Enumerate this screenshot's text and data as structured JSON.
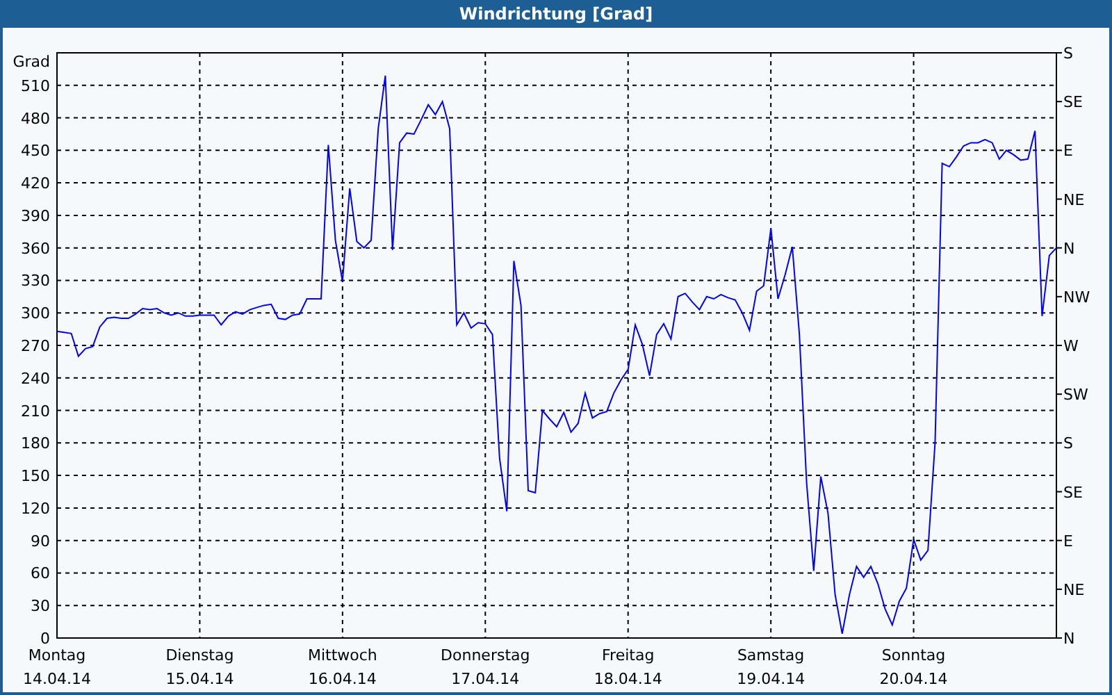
{
  "window": {
    "title": "Windrichtung [Grad]"
  },
  "chart": {
    "right_axis_labels": [
      "S",
      "SE",
      "E",
      "NE",
      "N",
      "NW",
      "W",
      "SW",
      "S",
      "SE",
      "E",
      "NE",
      "N"
    ],
    "x_axis_dates": [
      "14.04.14",
      "15.04.14",
      "16.04.14",
      "17.04.14",
      "18.04.14",
      "19.04.14",
      "20.04.14"
    ],
    "chart_data": {
      "type": "line",
      "ylabel": "Grad",
      "ylim": [
        0,
        540
      ],
      "grid": true,
      "yticks": [
        {
          "value": 0,
          "label": "0"
        },
        {
          "value": 30,
          "label": "30"
        },
        {
          "value": 60,
          "label": "60"
        },
        {
          "value": 90,
          "label": "90"
        },
        {
          "value": 120,
          "label": "120"
        },
        {
          "value": 150,
          "label": "150"
        },
        {
          "value": 180,
          "label": "180"
        },
        {
          "value": 210,
          "label": "210"
        },
        {
          "value": 240,
          "label": "240"
        },
        {
          "value": 270,
          "label": "270"
        },
        {
          "value": 300,
          "label": "300"
        },
        {
          "value": 330,
          "label": "330"
        },
        {
          "value": 360,
          "label": "360"
        },
        {
          "value": 390,
          "label": "390"
        },
        {
          "value": 420,
          "label": "420"
        },
        {
          "value": 450,
          "label": "450"
        },
        {
          "value": 480,
          "label": "480"
        },
        {
          "value": 510,
          "label": "510"
        }
      ],
      "categories": [
        "Montag",
        null,
        null,
        null,
        null,
        null,
        null,
        null,
        null,
        null,
        null,
        null,
        null,
        null,
        null,
        null,
        null,
        null,
        null,
        null,
        "Dienstag",
        null,
        null,
        null,
        null,
        null,
        null,
        null,
        null,
        null,
        null,
        null,
        null,
        null,
        null,
        null,
        null,
        null,
        null,
        null,
        "Mittwoch",
        null,
        null,
        null,
        null,
        null,
        null,
        null,
        null,
        null,
        null,
        null,
        null,
        null,
        null,
        null,
        null,
        null,
        null,
        null,
        "Donnerstag",
        null,
        null,
        null,
        null,
        null,
        null,
        null,
        null,
        null,
        null,
        null,
        null,
        null,
        null,
        null,
        null,
        null,
        null,
        null,
        "Freitag",
        null,
        null,
        null,
        null,
        null,
        null,
        null,
        null,
        null,
        null,
        null,
        null,
        null,
        null,
        null,
        null,
        null,
        null,
        null,
        "Samstag",
        null,
        null,
        null,
        null,
        null,
        null,
        null,
        null,
        null,
        null,
        null,
        null,
        null,
        null,
        null,
        null,
        null,
        null,
        null,
        "Sonntag",
        null,
        null,
        null,
        null,
        null,
        null,
        null,
        null,
        null,
        null,
        null,
        null,
        null,
        null,
        null,
        null,
        null,
        null,
        null,
        null
      ],
      "series": [
        {
          "color": "#0000ff",
          "values": [
            283,
            282,
            281,
            260,
            267,
            269,
            287,
            295,
            296,
            295,
            295,
            299,
            304,
            303,
            304,
            300,
            298,
            300,
            297,
            297,
            298,
            298,
            298,
            289,
            297,
            301,
            299,
            303,
            305,
            307,
            308,
            295,
            294,
            298,
            299,
            313,
            313,
            313,
            455,
            367,
            329,
            415,
            366,
            360,
            367,
            470,
            519,
            358,
            457,
            466,
            465,
            478,
            492,
            483,
            495,
            470,
            289,
            300,
            286,
            291,
            290,
            280,
            166,
            117,
            348,
            307,
            136,
            134,
            210,
            202,
            195,
            208,
            190,
            198,
            226,
            203,
            207,
            209,
            226,
            238,
            248,
            289,
            271,
            242,
            280,
            290,
            276,
            315,
            318,
            310,
            303,
            315,
            313,
            317,
            314,
            312,
            300,
            284,
            320,
            325,
            378,
            313,
            335,
            361,
            280,
            143,
            62,
            149,
            115,
            40,
            4,
            40,
            66,
            56,
            66,
            50,
            27,
            12,
            34,
            46,
            91,
            72,
            81,
            180,
            438,
            435,
            444,
            454,
            457,
            457,
            460,
            457,
            442,
            450,
            446,
            441,
            442,
            468,
            297,
            353,
            360
          ]
        }
      ]
    }
  }
}
